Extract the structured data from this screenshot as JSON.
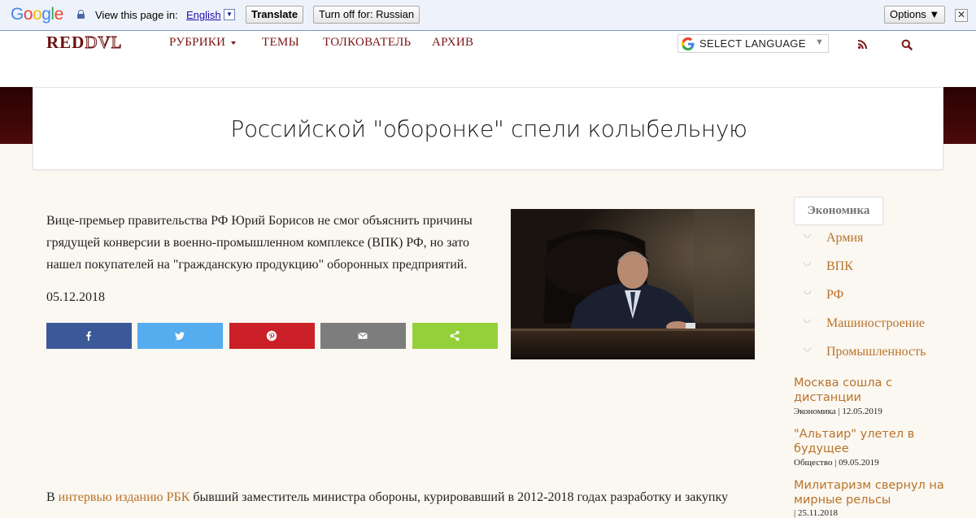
{
  "translate_bar": {
    "logo": "Google",
    "view_text": "View this page in:",
    "language": "English",
    "caret": "▼",
    "translate_label": "Translate",
    "turn_off_label": "Turn off for: Russian",
    "options_label": "Options ▼",
    "close_label": "✕"
  },
  "header": {
    "logo_red": "RED",
    "logo_dvl": "DVL",
    "nav": [
      "РУБРИКИ",
      "ТЕМЫ",
      "ТОЛКОВАТЕЛЬ",
      "АРХИВ"
    ],
    "language_select": "SELECT LANGUAGE",
    "language_arrow": "▼",
    "icons": [
      "rss-icon",
      "search-icon"
    ]
  },
  "article": {
    "title": "Российской \"оборонке\" спели колыбельную",
    "lead": "Вице-премьер правительства РФ Юрий Борисов не смог объяснить причины грядущей конверсии в военно-промышленном комплексе (ВПК) РФ, но зато нашел покупателей на \"гражданскую продукцию\" оборонных предприятий.",
    "date": "05.12.2018",
    "share_icons": [
      "facebook-icon",
      "twitter-icon",
      "pinterest-icon",
      "email-icon",
      "share-icon"
    ],
    "body_prefix": "В ",
    "body_link": "интервью изданию РБК",
    "body_rest": " бывший заместитель министра обороны, курировавший в 2012-2018 годах разработку и закупку"
  },
  "sidebar": {
    "category": "Экономика",
    "tags": [
      "Армия",
      "ВПК",
      "РФ",
      "Машиностроение",
      "Промышленность"
    ],
    "news": [
      {
        "title": "Москва сошла с дистанции",
        "meta": "Экономика | 12.05.2019"
      },
      {
        "title": "\"Альтаир\" улетел в будущее",
        "meta": "Общество | 09.05.2019"
      },
      {
        "title": "Милитаризм свернул на мирные рельсы",
        "meta": "| 25.11.2018"
      }
    ]
  },
  "colors": {
    "accent": "#b8732a",
    "nav": "#7b1414",
    "facebook": "#3b5998",
    "twitter": "#55acee",
    "pinterest": "#cb2027",
    "email": "#7d7d7d",
    "share": "#95d03a"
  }
}
